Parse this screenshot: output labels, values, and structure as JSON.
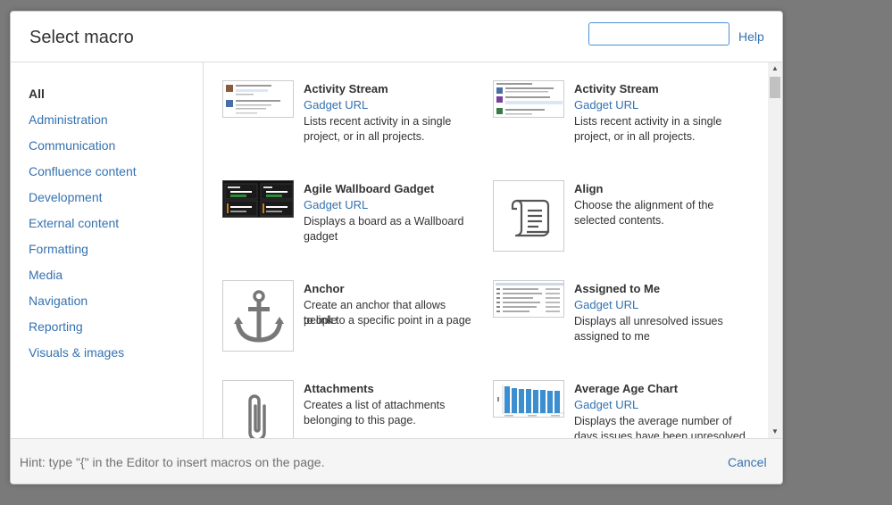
{
  "dialog": {
    "title": "Select macro",
    "search": {
      "value": "",
      "placeholder": ""
    },
    "help_label": "Help"
  },
  "sidebar": {
    "items": [
      {
        "label": "All",
        "active": true
      },
      {
        "label": "Administration"
      },
      {
        "label": "Communication"
      },
      {
        "label": "Confluence content"
      },
      {
        "label": "Development"
      },
      {
        "label": "External content"
      },
      {
        "label": "Formatting"
      },
      {
        "label": "Media"
      },
      {
        "label": "Navigation"
      },
      {
        "label": "Reporting"
      },
      {
        "label": "Visuals & images"
      }
    ]
  },
  "macros": [
    {
      "name": "Activity Stream",
      "sub": "Gadget URL",
      "desc": [
        "Lists recent activity in a single",
        "project, or in all projects."
      ]
    },
    {
      "name": "Activity Stream",
      "sub": "Gadget URL",
      "desc": [
        "Lists recent activity in a single",
        "project, or in all projects."
      ]
    },
    {
      "name": "Agile Wallboard Gadget",
      "sub": "Gadget URL",
      "desc": [
        "Displays a board as a Wallboard",
        "gadget"
      ]
    },
    {
      "name": "Align",
      "sub": "",
      "desc": [
        "Choose the alignment of the",
        "selected contents."
      ]
    },
    {
      "name": "Anchor",
      "sub": "",
      "desc": [
        "Create an anchor that allows people",
        "to link to a specific point in a page"
      ]
    },
    {
      "name": "Assigned to Me",
      "sub": "Gadget URL",
      "desc": [
        "Displays all unresolved issues",
        "assigned to me"
      ]
    },
    {
      "name": "Attachments",
      "sub": "",
      "desc": [
        "Creates a list of attachments",
        "belonging to this page."
      ]
    },
    {
      "name": "Average Age Chart",
      "sub": "Gadget URL",
      "desc": [
        "Displays the average number of",
        "days issues have been unresolved."
      ]
    }
  ],
  "footer": {
    "hint": "Hint: type \"{\" in the Editor to insert macros on the page.",
    "cancel_label": "Cancel"
  },
  "colors": {
    "link": "#3572b0",
    "focus": "#4a90d9"
  }
}
